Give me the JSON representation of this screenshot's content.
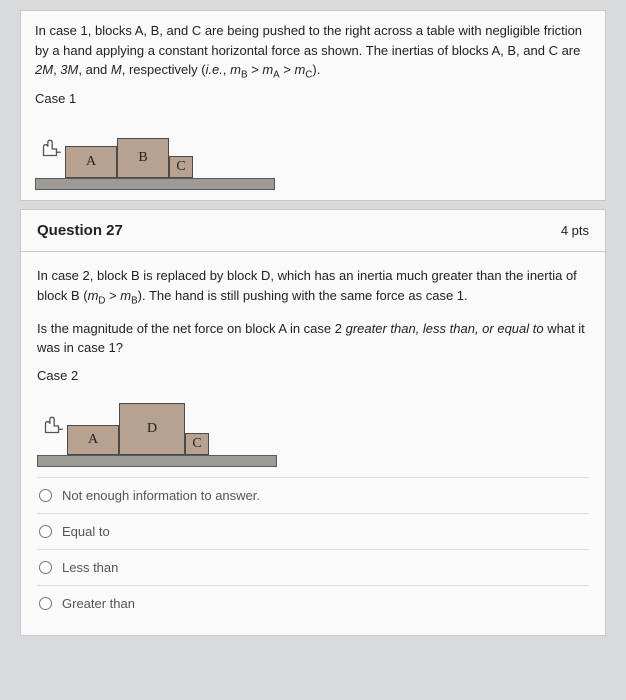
{
  "intro": {
    "text": "In case 1, blocks A, B, and C are being pushed to the right across a table with negligible friction by a hand applying a constant horizontal force as shown. The inertias of blocks A, B, and C are 2M, 3M, and M, respectively (i.e., m_B > m_A > m_C).",
    "case_label": "Case 1",
    "blocks": {
      "A": "A",
      "B": "B",
      "C": "C"
    }
  },
  "question": {
    "number": "Question 27",
    "points": "4 pts",
    "p1": "In case 2, block B is replaced by block D, which has an inertia much greater than the inertia of block B (m_D > m_B). The hand is still pushing with the same force as case 1.",
    "p2_pre": "Is the magnitude of the net force on block A in case 2 ",
    "p2_em": "greater than, less than, or equal to",
    "p2_post": " what it was in case 1?",
    "case_label": "Case 2",
    "blocks": {
      "A": "A",
      "D": "D",
      "C": "C"
    },
    "options": [
      "Not enough information to answer.",
      "Equal to",
      "Less than",
      "Greater than"
    ]
  }
}
